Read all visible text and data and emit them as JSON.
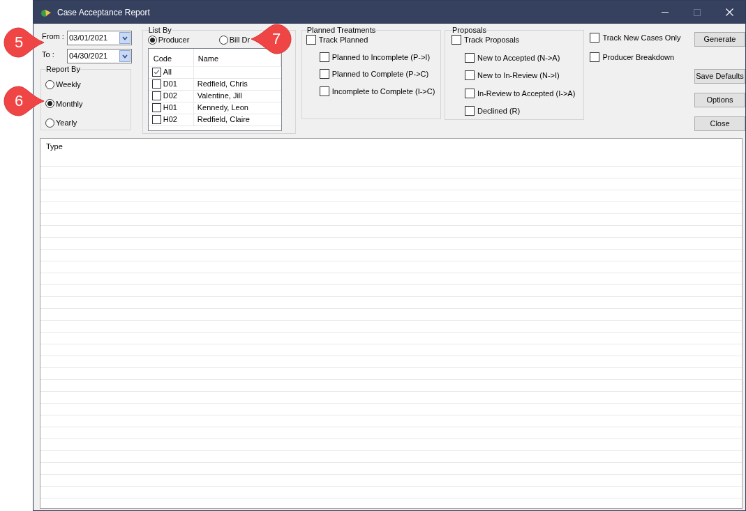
{
  "window": {
    "title": "Case Acceptance Report"
  },
  "date_range": {
    "from": {
      "label": "From :",
      "value": "03/01/2021"
    },
    "to": {
      "label": "To :",
      "value": "04/30/2021"
    }
  },
  "report_by": {
    "title": "Report By",
    "options": [
      {
        "label": "Weekly",
        "selected": false
      },
      {
        "label": "Monthly",
        "selected": true
      },
      {
        "label": "Yearly",
        "selected": false
      }
    ]
  },
  "list_by": {
    "title": "List By",
    "options": [
      {
        "label": "Producer",
        "selected": true
      },
      {
        "label": "Bill Dr",
        "selected": false
      }
    ],
    "table": {
      "columns": [
        "Code",
        "Name"
      ],
      "rows": [
        {
          "code": "All",
          "name": "",
          "checked": true
        },
        {
          "code": "D01",
          "name": "Redfield, Chris",
          "checked": false
        },
        {
          "code": "D02",
          "name": "Valentine, Jill",
          "checked": false
        },
        {
          "code": "H01",
          "name": "Kennedy, Leon",
          "checked": false
        },
        {
          "code": "H02",
          "name": "Redfield, Claire",
          "checked": false
        }
      ]
    }
  },
  "planned_treatments": {
    "title": "Planned Treatments",
    "track": {
      "label": "Track Planned",
      "checked": false
    },
    "options": [
      {
        "label": "Planned to Incomplete (P->I)",
        "checked": false
      },
      {
        "label": "Planned to Complete (P->C)",
        "checked": false
      },
      {
        "label": "Incomplete to Complete (I->C)",
        "checked": false
      }
    ]
  },
  "proposals": {
    "title": "Proposals",
    "track": {
      "label": "Track Proposals",
      "checked": false
    },
    "options": [
      {
        "label": "New to Accepted (N->A)",
        "checked": false
      },
      {
        "label": "New to In-Review (N->I)",
        "checked": false
      },
      {
        "label": "In-Review to Accepted (I->A)",
        "checked": false
      },
      {
        "label": "Declined (R)",
        "checked": false
      }
    ]
  },
  "extra_options": [
    {
      "label": "Track New Cases Only",
      "checked": false
    },
    {
      "label": "Producer Breakdown",
      "checked": false
    }
  ],
  "buttons": [
    "Generate",
    "Save Defaults",
    "Options",
    "Close"
  ],
  "report_grid": {
    "columns": [
      "Type"
    ]
  },
  "callouts": [
    "5",
    "6",
    "7"
  ]
}
